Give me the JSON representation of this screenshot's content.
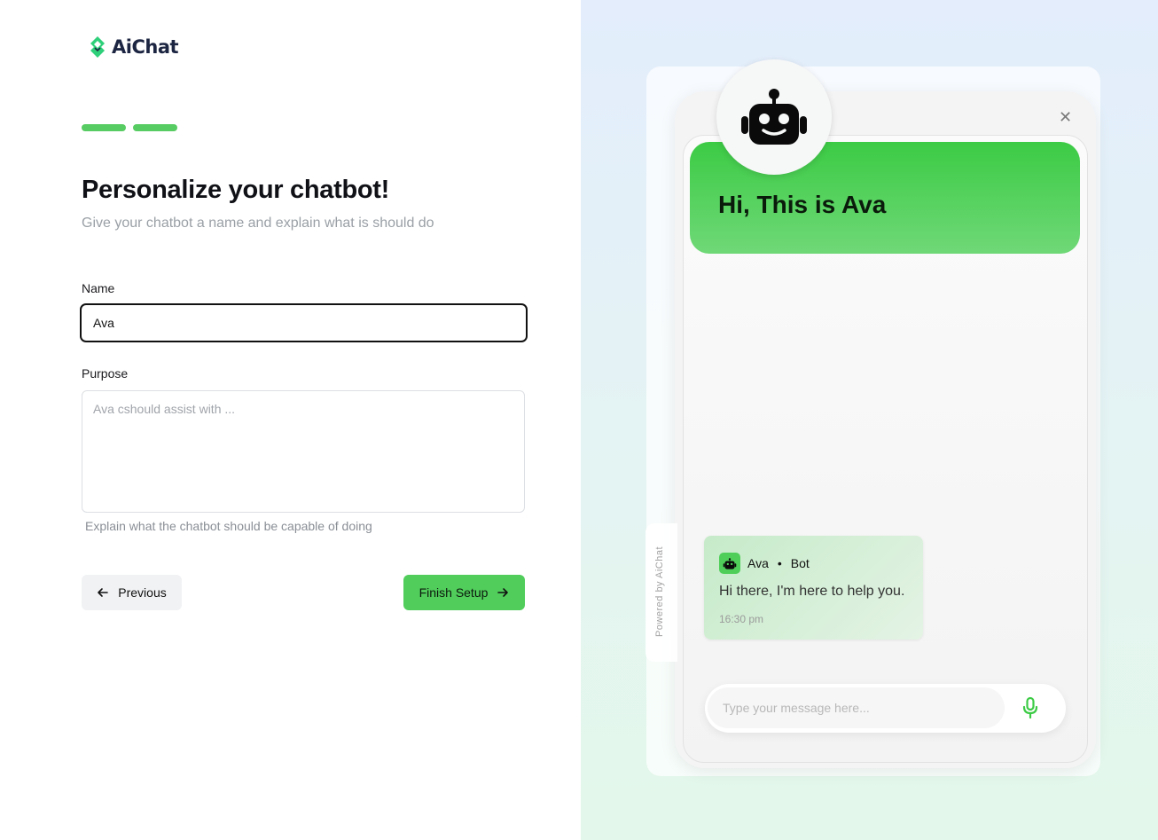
{
  "brand": {
    "name": "AiChat",
    "color": "#1c2541",
    "accent": "#3ecf8e"
  },
  "progress": {
    "steps_total": 2,
    "steps_completed": 2,
    "color": "#57cc62"
  },
  "form": {
    "title": "Personalize your chatbot!",
    "subtitle": "Give your chatbot a name and explain what is should do",
    "name_label": "Name",
    "name_value": "Ava",
    "purpose_label": "Purpose",
    "purpose_placeholder": "Ava cshould assist with ...",
    "purpose_helper": "Explain what the chatbot should be capable of doing",
    "previous_label": "Previous",
    "finish_label": "Finish Setup"
  },
  "preview": {
    "greeting": "Hi, This is Ava",
    "powered_by": "Powered by AiChat",
    "close_icon": "close-icon",
    "message": {
      "bot_name": "Ava",
      "role": "Bot",
      "text": "Hi there, I'm here to help you.",
      "time": "16:30 pm"
    },
    "composer_placeholder": "Type your message here...",
    "accent": "#3ccb45"
  }
}
